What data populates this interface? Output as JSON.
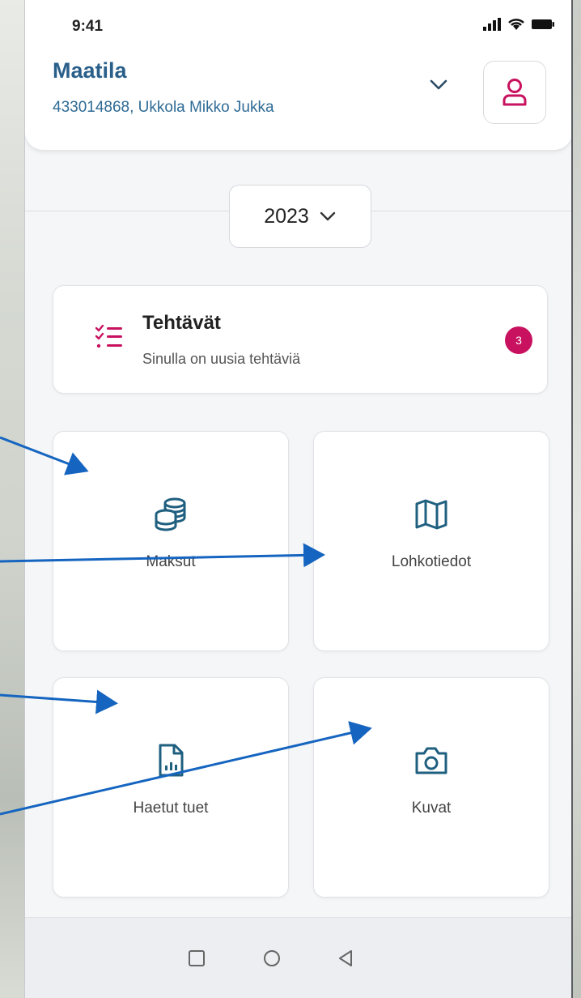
{
  "status_bar": {
    "time": "9:41",
    "signal_icon": "signal-icon",
    "wifi_icon": "wifi-icon",
    "battery_icon": "battery-icon"
  },
  "header": {
    "title": "Maatila",
    "subtitle": "433014868, Ukkola Mikko Jukka",
    "dropdown_icon": "chevron-down-icon",
    "profile_icon": "user-icon"
  },
  "year_select": {
    "value": "2023",
    "icon": "chevron-down-icon"
  },
  "tasks": {
    "title": "Tehtävät",
    "subtitle": "Sinulla on uusia tehtäviä",
    "badge": "3",
    "icon": "checklist-icon"
  },
  "tiles": [
    {
      "label": "Maksut",
      "icon": "coins-icon"
    },
    {
      "label": "Lohkotiedot",
      "icon": "map-icon"
    },
    {
      "label": "Haetut tuet",
      "icon": "document-chart-icon"
    },
    {
      "label": "Kuvat",
      "icon": "camera-icon"
    }
  ],
  "nav_bar": {
    "recent_icon": "square-icon",
    "home_icon": "circle-icon",
    "back_icon": "triangle-back-icon"
  },
  "colors": {
    "primary": "#2a5f8a",
    "accent": "#c8125f",
    "icon": "#1f5f7f"
  }
}
